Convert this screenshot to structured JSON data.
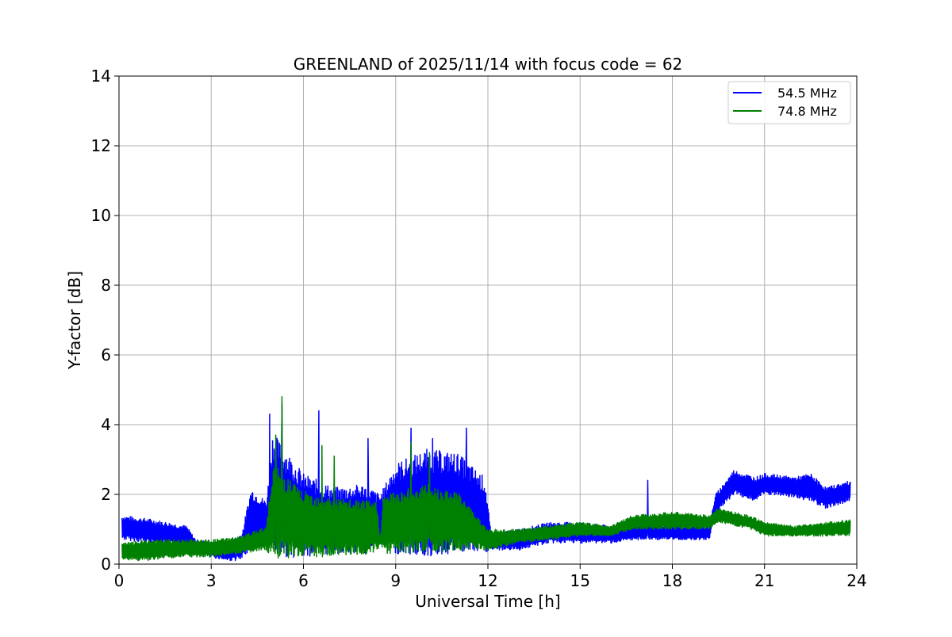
{
  "chart_data": {
    "type": "line",
    "title": "GREENLAND of 2025/11/14 with focus code = 62",
    "xlabel": "Universal Time [h]",
    "ylabel": "Y-factor [dB]",
    "xlim": [
      0,
      24
    ],
    "ylim": [
      0,
      14
    ],
    "xticks": [
      0,
      3,
      6,
      9,
      12,
      15,
      18,
      21,
      24
    ],
    "yticks": [
      0,
      2,
      4,
      6,
      8,
      10,
      12,
      14
    ],
    "grid": true,
    "legend_position": "top-right",
    "series": [
      {
        "name": "54.5 MHz",
        "color": "#0000ff",
        "envelope": [
          {
            "x": 0.1,
            "low": 0.7,
            "high": 1.4
          },
          {
            "x": 1.0,
            "low": 0.6,
            "high": 1.3
          },
          {
            "x": 2.2,
            "low": 0.5,
            "high": 1.1
          },
          {
            "x": 2.5,
            "low": 0.3,
            "high": 0.7
          },
          {
            "x": 3.5,
            "low": 0.1,
            "high": 0.6
          },
          {
            "x": 4.0,
            "low": 0.1,
            "high": 0.9
          },
          {
            "x": 4.3,
            "low": 0.5,
            "high": 2.2
          },
          {
            "x": 4.8,
            "low": 0.8,
            "high": 1.8
          },
          {
            "x": 5.0,
            "low": 0.2,
            "high": 3.8
          },
          {
            "x": 6.0,
            "low": 0.2,
            "high": 2.6
          },
          {
            "x": 7.0,
            "low": 0.3,
            "high": 2.2
          },
          {
            "x": 8.0,
            "low": 0.3,
            "high": 2.3
          },
          {
            "x": 8.5,
            "low": 0.6,
            "high": 2.0
          },
          {
            "x": 9.0,
            "low": 0.3,
            "high": 2.9
          },
          {
            "x": 10.0,
            "low": 0.2,
            "high": 3.3
          },
          {
            "x": 11.0,
            "low": 0.3,
            "high": 3.2
          },
          {
            "x": 11.9,
            "low": 0.3,
            "high": 2.5
          },
          {
            "x": 12.1,
            "low": 0.4,
            "high": 0.9
          },
          {
            "x": 13.0,
            "low": 0.4,
            "high": 1.0
          },
          {
            "x": 14.0,
            "low": 0.6,
            "high": 1.2
          },
          {
            "x": 15.0,
            "low": 0.6,
            "high": 1.2
          },
          {
            "x": 16.0,
            "low": 0.6,
            "high": 1.1
          },
          {
            "x": 17.0,
            "low": 0.7,
            "high": 1.2
          },
          {
            "x": 18.0,
            "low": 0.7,
            "high": 1.1
          },
          {
            "x": 19.2,
            "low": 0.7,
            "high": 1.1
          },
          {
            "x": 19.4,
            "low": 1.4,
            "high": 2.0
          },
          {
            "x": 20.0,
            "low": 2.0,
            "high": 2.7
          },
          {
            "x": 20.7,
            "low": 1.8,
            "high": 2.5
          },
          {
            "x": 21.0,
            "low": 2.0,
            "high": 2.6
          },
          {
            "x": 22.0,
            "low": 1.9,
            "high": 2.5
          },
          {
            "x": 22.5,
            "low": 1.8,
            "high": 2.6
          },
          {
            "x": 23.0,
            "low": 1.6,
            "high": 2.2
          },
          {
            "x": 23.8,
            "low": 1.8,
            "high": 2.4
          }
        ],
        "peaks": [
          {
            "x": 4.9,
            "y": 4.3
          },
          {
            "x": 5.3,
            "y": 4.6
          },
          {
            "x": 6.5,
            "y": 4.4
          },
          {
            "x": 8.1,
            "y": 3.6
          },
          {
            "x": 9.5,
            "y": 3.9
          },
          {
            "x": 10.2,
            "y": 3.6
          },
          {
            "x": 11.3,
            "y": 3.9
          },
          {
            "x": 17.2,
            "y": 2.4
          }
        ]
      },
      {
        "name": "74.8 MHz",
        "color": "#008000",
        "envelope": [
          {
            "x": 0.1,
            "low": 0.1,
            "high": 0.6
          },
          {
            "x": 1.0,
            "low": 0.1,
            "high": 0.7
          },
          {
            "x": 2.0,
            "low": 0.2,
            "high": 0.7
          },
          {
            "x": 3.0,
            "low": 0.2,
            "high": 0.7
          },
          {
            "x": 4.0,
            "low": 0.3,
            "high": 0.8
          },
          {
            "x": 4.8,
            "low": 0.4,
            "high": 1.1
          },
          {
            "x": 5.0,
            "low": 0.1,
            "high": 2.9
          },
          {
            "x": 6.0,
            "low": 0.2,
            "high": 2.1
          },
          {
            "x": 7.0,
            "low": 0.2,
            "high": 1.9
          },
          {
            "x": 8.4,
            "low": 0.3,
            "high": 1.8
          },
          {
            "x": 8.5,
            "low": 0.6,
            "high": 0.6
          },
          {
            "x": 8.6,
            "low": 0.3,
            "high": 2.0
          },
          {
            "x": 10.0,
            "low": 0.3,
            "high": 2.3
          },
          {
            "x": 11.0,
            "low": 0.4,
            "high": 2.1
          },
          {
            "x": 12.0,
            "low": 0.4,
            "high": 1.0
          },
          {
            "x": 13.0,
            "low": 0.6,
            "high": 1.0
          },
          {
            "x": 14.0,
            "low": 0.7,
            "high": 1.1
          },
          {
            "x": 15.0,
            "low": 0.8,
            "high": 1.2
          },
          {
            "x": 16.0,
            "low": 0.8,
            "high": 1.1
          },
          {
            "x": 16.7,
            "low": 1.0,
            "high": 1.4
          },
          {
            "x": 18.0,
            "low": 1.0,
            "high": 1.5
          },
          {
            "x": 19.2,
            "low": 1.0,
            "high": 1.4
          },
          {
            "x": 19.5,
            "low": 1.2,
            "high": 1.6
          },
          {
            "x": 20.5,
            "low": 1.0,
            "high": 1.4
          },
          {
            "x": 21.0,
            "low": 0.8,
            "high": 1.2
          },
          {
            "x": 22.0,
            "low": 0.8,
            "high": 1.1
          },
          {
            "x": 23.0,
            "low": 0.8,
            "high": 1.2
          },
          {
            "x": 23.8,
            "low": 0.8,
            "high": 1.3
          }
        ],
        "peaks": [
          {
            "x": 5.1,
            "y": 3.7
          },
          {
            "x": 5.3,
            "y": 4.8
          },
          {
            "x": 6.6,
            "y": 3.4
          },
          {
            "x": 7.0,
            "y": 3.1
          },
          {
            "x": 9.5,
            "y": 3.5
          },
          {
            "x": 10.1,
            "y": 3.2
          }
        ]
      }
    ]
  }
}
